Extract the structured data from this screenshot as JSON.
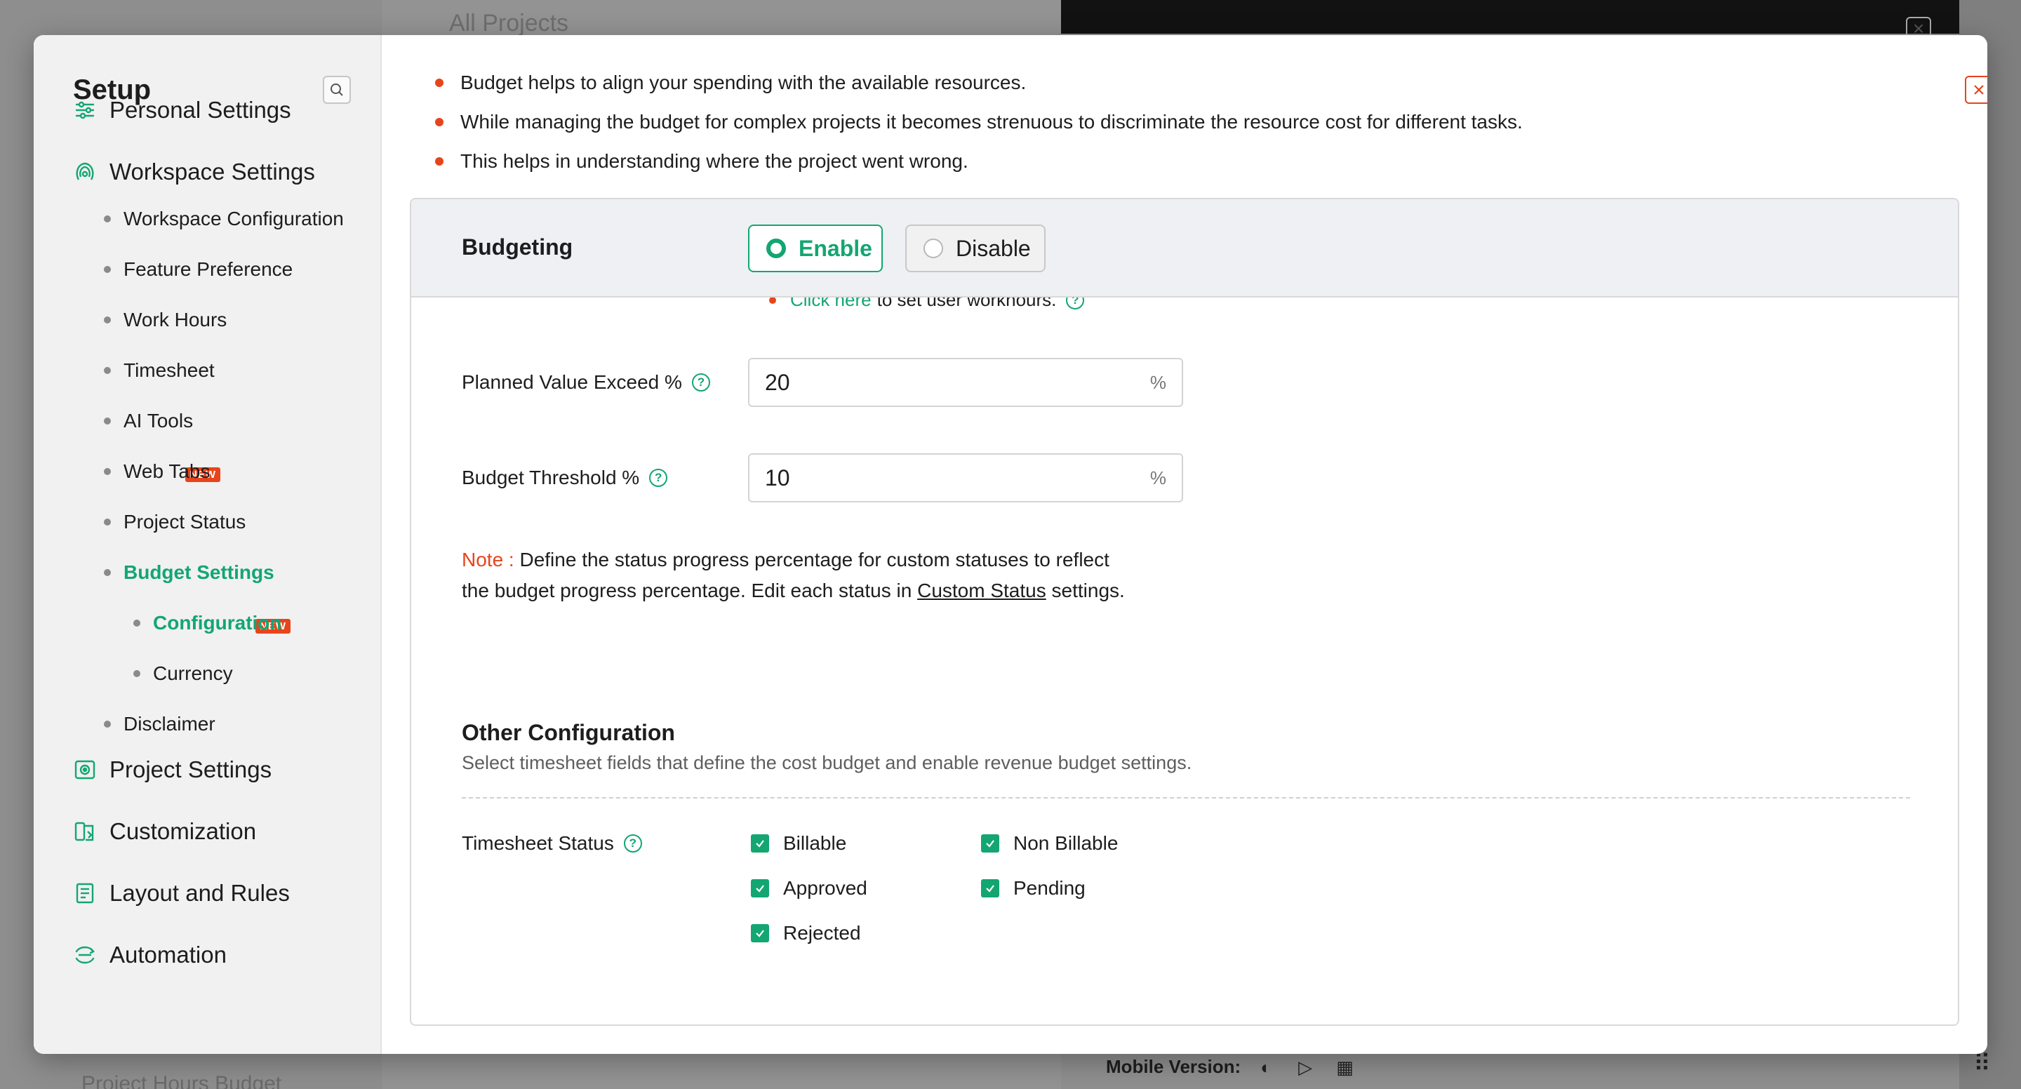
{
  "background": {
    "title": "All Projects",
    "bottom_text": "Project Hours Budget",
    "mobile_label": "Mobile Version:"
  },
  "sidebar": {
    "title": "Setup",
    "groups": [
      {
        "label": "Personal Settings",
        "icon": "sliders-icon"
      },
      {
        "label": "Workspace Settings",
        "icon": "workspace-icon"
      },
      {
        "label": "Project Settings",
        "icon": "project-icon"
      },
      {
        "label": "Customization",
        "icon": "customization-icon"
      },
      {
        "label": "Layout and Rules",
        "icon": "layout-icon"
      },
      {
        "label": "Automation",
        "icon": "automation-icon"
      }
    ],
    "workspace_items": [
      {
        "label": "Workspace Configuration"
      },
      {
        "label": "Feature Preference"
      },
      {
        "label": "Work Hours"
      },
      {
        "label": "Timesheet"
      },
      {
        "label": "AI Tools",
        "badge": "NEW"
      },
      {
        "label": "Web Tabs"
      },
      {
        "label": "Project Status"
      },
      {
        "label": "Budget Settings",
        "badge": "NEW",
        "active": true
      },
      {
        "label": "Disclaimer"
      }
    ],
    "budget_subitems": [
      {
        "label": "Configuration",
        "active": true
      },
      {
        "label": "Currency"
      }
    ]
  },
  "content": {
    "bullets": [
      "Budget helps to align your spending with the available resources.",
      "While managing the budget for complex projects it becomes strenuous to discriminate the resource cost for different tasks.",
      "This helps in understanding where the project went wrong."
    ],
    "budgeting": {
      "label": "Budgeting",
      "enable_label": "Enable",
      "disable_label": "Disable",
      "selected": "Enable"
    },
    "hint": {
      "link": "Click here",
      "text": "to set user workhours."
    },
    "fields": [
      {
        "label": "Planned Value Exceed %",
        "value": "20",
        "unit": "%"
      },
      {
        "label": "Budget Threshold %",
        "value": "10",
        "unit": "%"
      }
    ],
    "note": {
      "label": "Note :",
      "text1": "Define the status progress percentage for custom statuses to reflect the budget progress percentage. Edit each status in",
      "link": "Custom Status",
      "text2": "settings."
    },
    "other_config": {
      "title": "Other Configuration",
      "subtitle": "Select timesheet fields that define the cost budget and enable revenue budget settings."
    },
    "timesheet_status": {
      "label": "Timesheet Status",
      "options": [
        {
          "label": "Billable",
          "checked": true
        },
        {
          "label": "Non Billable",
          "checked": true
        },
        {
          "label": "Approved",
          "checked": true
        },
        {
          "label": "Pending",
          "checked": true
        },
        {
          "label": "Rejected",
          "checked": true
        }
      ]
    }
  },
  "colors": {
    "accent": "#13a672",
    "danger": "#e8441c"
  }
}
